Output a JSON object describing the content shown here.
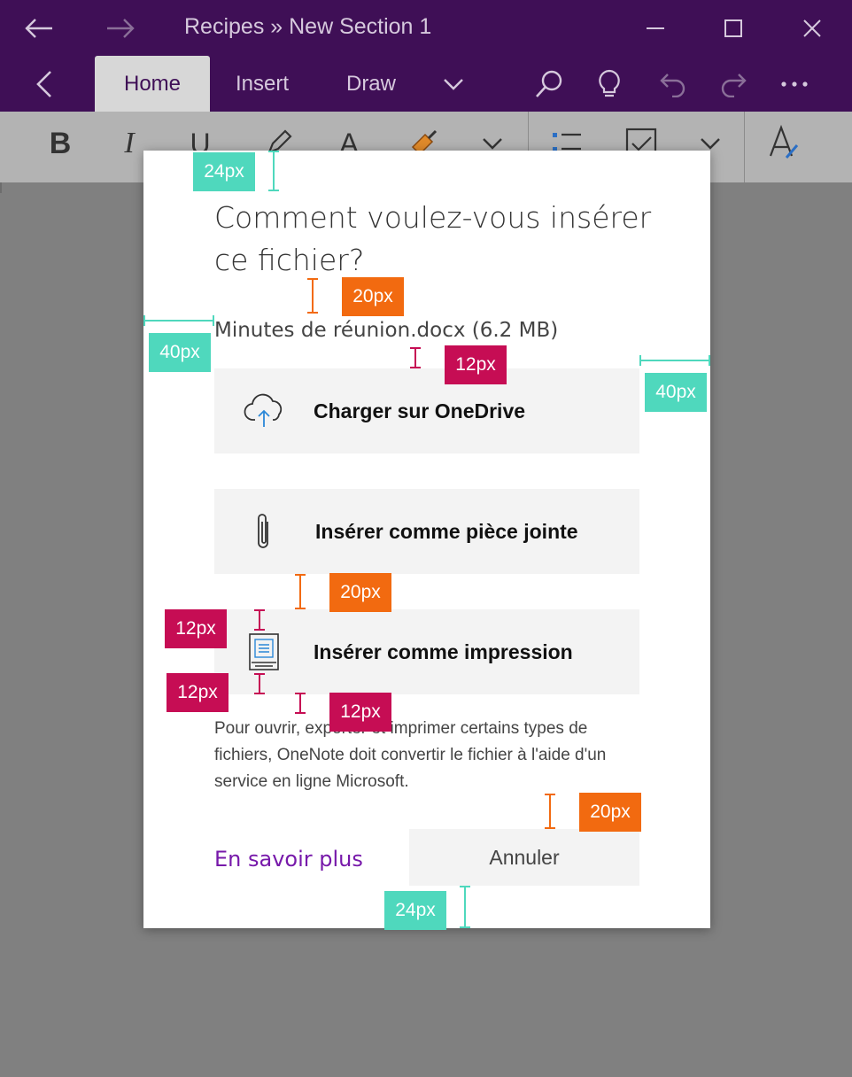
{
  "window": {
    "title": "Recipes » New Section 1",
    "icons": [
      "back-arrow-icon",
      "forward-arrow-icon",
      "minimize-icon",
      "maximize-icon",
      "close-icon"
    ]
  },
  "ribbon": {
    "tabs": [
      {
        "label": "Home",
        "active": true
      },
      {
        "label": "Insert",
        "active": false
      },
      {
        "label": "Draw",
        "active": false
      }
    ],
    "toolbar": {
      "bold": "B",
      "italic": "I",
      "underline": "U",
      "font_color": "A"
    }
  },
  "dialog": {
    "title": "Comment voulez-vous insérer ce fichier?",
    "file": "Minutes de réunion.docx (6.2 MB)",
    "options": [
      {
        "label": "Charger sur OneDrive",
        "icon": "cloud-upload-icon"
      },
      {
        "label": "Insérer comme pièce jointe",
        "icon": "paperclip-icon"
      },
      {
        "label": "Insérer comme impression",
        "icon": "printout-icon"
      }
    ],
    "note": "Pour ouvrir, exporter et imprimer certains types de fichiers, OneNote doit convertir le fichier à l'aide d'un service en ligne Microsoft.",
    "learn_more": "En savoir plus",
    "cancel": "Annuler"
  },
  "annotations": {
    "a1": "24px",
    "a2": "20px",
    "a3": "40px",
    "a4": "12px",
    "a5": "40px",
    "a6": "20px",
    "a7": "12px",
    "a8": "12px",
    "a9": "12px",
    "a10": "20px",
    "a11": "24px"
  },
  "colors": {
    "titlebar": "#3f0f56",
    "accent_link": "#7719aa",
    "teal": "#4fd8bd",
    "orange": "#f26a10",
    "crimson": "#c60d54"
  }
}
